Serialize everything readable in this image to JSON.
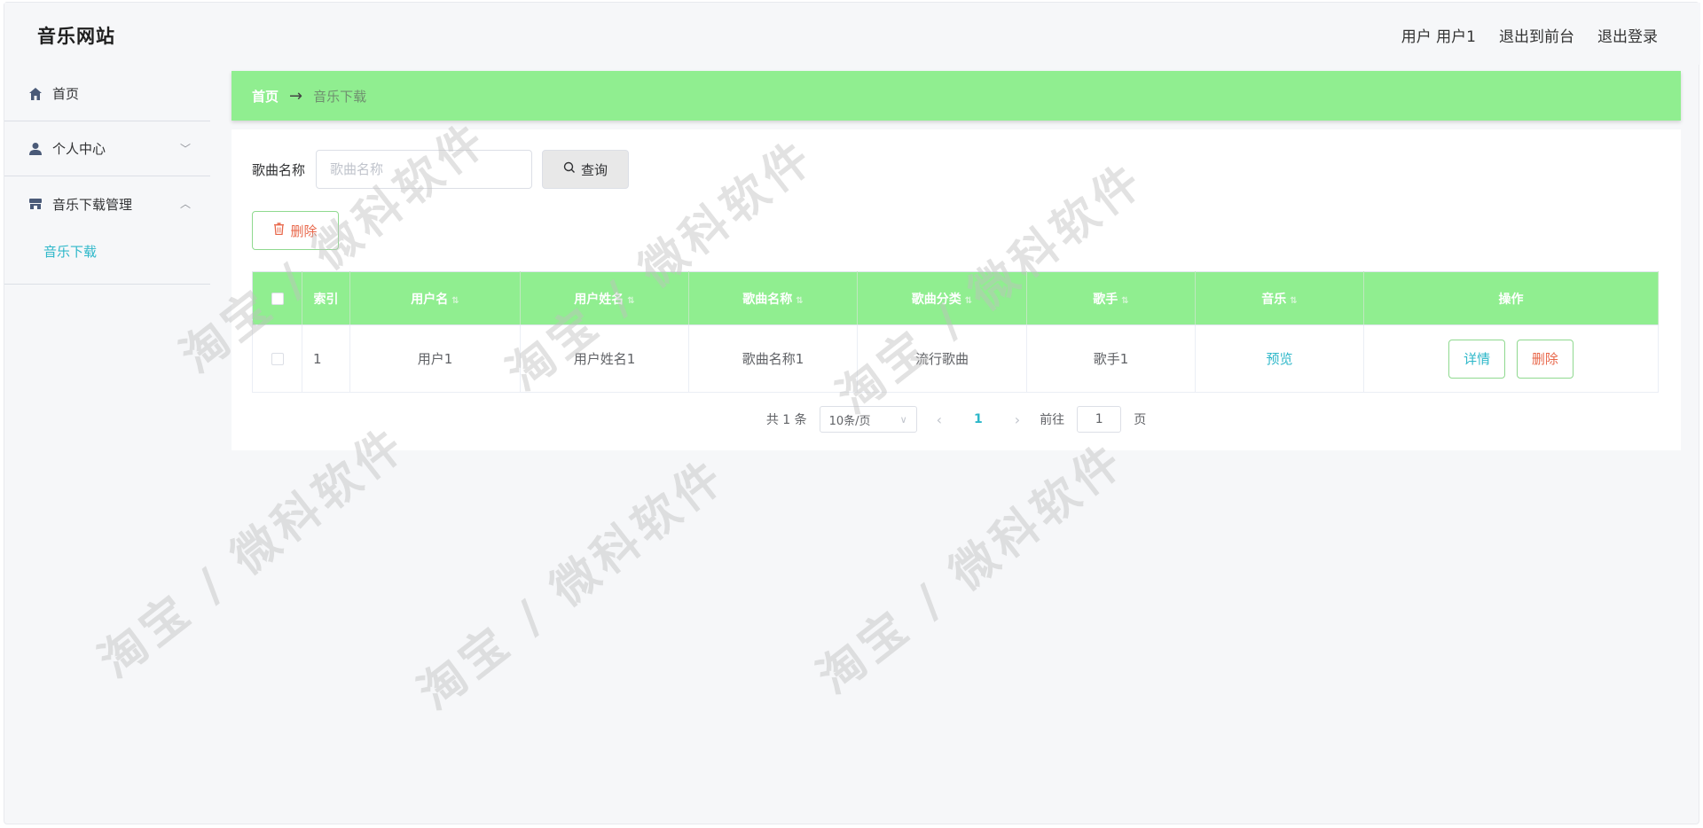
{
  "header": {
    "brand": "音乐网站",
    "links": [
      "用户 用户1",
      "退出到前台",
      "退出登录"
    ]
  },
  "sidebar": {
    "items": [
      {
        "label": "首页",
        "icon": "home-icon"
      },
      {
        "label": "个人中心",
        "icon": "user-icon",
        "arrow": "﹀"
      },
      {
        "label": "音乐下载管理",
        "icon": "store-icon",
        "arrow": "︿"
      }
    ],
    "submenu": [
      "音乐下载"
    ]
  },
  "breadcrumb": {
    "home": "首页",
    "separator": "→",
    "current": "音乐下载"
  },
  "search": {
    "label": "歌曲名称",
    "placeholder": "歌曲名称",
    "button": "查询"
  },
  "toolbar": {
    "delete": "删除"
  },
  "table": {
    "headers": [
      "",
      "索引",
      "用户名",
      "用户姓名",
      "歌曲名称",
      "歌曲分类",
      "歌手",
      "音乐",
      "操作"
    ],
    "rows": [
      {
        "index": "1",
        "username": "用户1",
        "realname": "用户姓名1",
        "song": "歌曲名称1",
        "category": "流行歌曲",
        "singer": "歌手1",
        "music": "预览",
        "detail": "详情",
        "delete": "删除"
      }
    ]
  },
  "pagination": {
    "total": "共 1 条",
    "page_size": "10条/页",
    "current": "1",
    "goto_label": "前往",
    "goto_value": "1",
    "page_unit": "页"
  },
  "watermark": "淘宝 / 微科软件",
  "colors": {
    "accent": "#90ee90",
    "link": "#2db7c9",
    "danger": "#e8674a"
  }
}
